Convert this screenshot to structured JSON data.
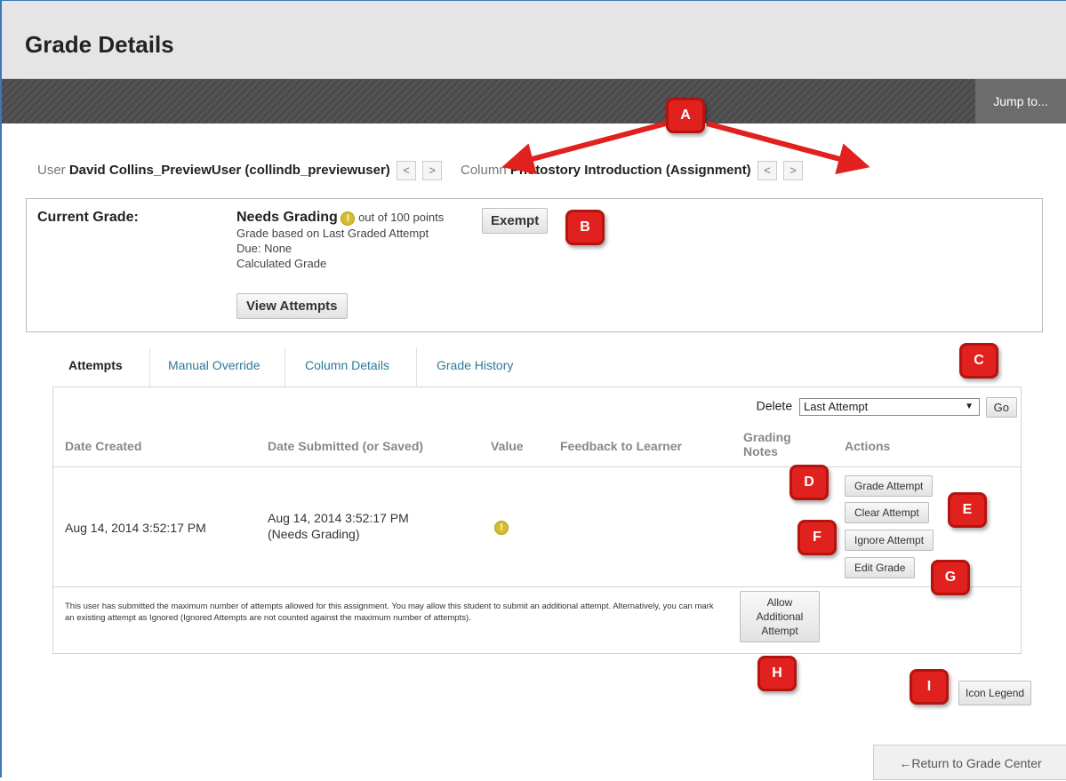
{
  "page": {
    "title": "Grade Details",
    "jump_label": "Jump to..."
  },
  "navigation": {
    "user_label": "User",
    "user_value": "David Collins_PreviewUser (collindb_previewuser)",
    "column_label": "Column",
    "column_value": "Photostory Introduction (Assignment)",
    "prev_glyph": "<",
    "next_glyph": ">"
  },
  "current_grade": {
    "label": "Current Grade:",
    "status": "Needs Grading",
    "out_of": "out of 100 points",
    "exempt_label": "Exempt",
    "basis": "Grade based on Last Graded Attempt",
    "due": "Due: None",
    "calculated": "Calculated Grade",
    "view_attempts_label": "View Attempts"
  },
  "tabs": [
    {
      "label": "Attempts",
      "active": true
    },
    {
      "label": "Manual Override",
      "active": false
    },
    {
      "label": "Column Details",
      "active": false
    },
    {
      "label": "Grade History",
      "active": false
    }
  ],
  "attempts": {
    "delete_label": "Delete",
    "delete_selected": "Last Attempt",
    "go_label": "Go",
    "columns": [
      "Date Created",
      "Date Submitted (or Saved)",
      "Value",
      "Feedback to Learner",
      "Grading Notes",
      "Actions"
    ],
    "row": {
      "date_created": "Aug 14, 2014 3:52:17 PM",
      "date_submitted": "Aug 14, 2014 3:52:17 PM",
      "submitted_status": "(Needs Grading)"
    },
    "actions": [
      "Grade Attempt",
      "Clear Attempt",
      "Ignore Attempt",
      "Edit Grade"
    ],
    "footnote": "This user has submitted the maximum number of attempts allowed for this assignment. You may allow this student to submit an additional attempt. Alternatively, you can mark an existing attempt as Ignored (Ignored Attempts are not counted against the maximum number of attempts).",
    "allow_additional_label": "Allow Additional Attempt"
  },
  "icon_legend_label": "Icon Legend",
  "return_label": "←Return to Grade Center",
  "callouts": [
    "A",
    "B",
    "C",
    "D",
    "E",
    "F",
    "G",
    "H",
    "I"
  ],
  "icons": {
    "warning": "needs-grading-icon"
  },
  "colors": {
    "callout_red": "#e0211d",
    "link_teal": "#2b7a9a",
    "warning_yellow": "#d6bc2f"
  }
}
